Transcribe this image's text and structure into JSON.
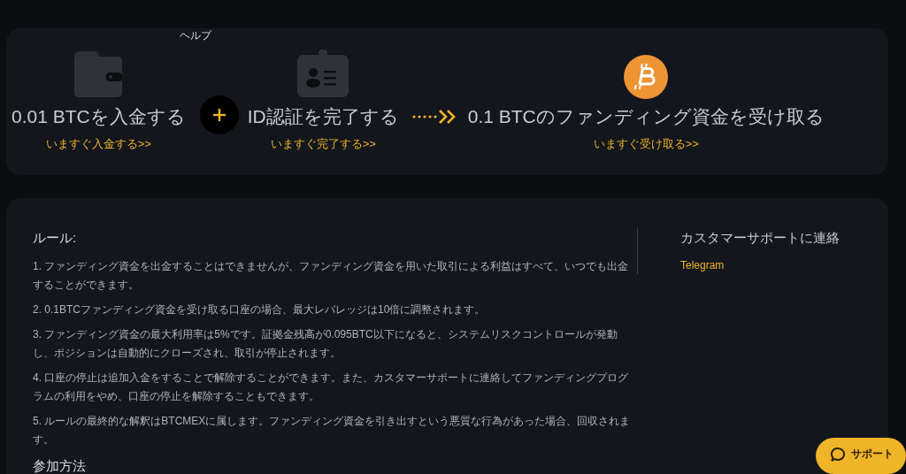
{
  "help_label": "ヘルプ",
  "steps": [
    {
      "kind": "wallet",
      "title": "0.01 BTCを入金する",
      "link": "いますぐ入金する>>"
    },
    {
      "kind": "id-card",
      "title": "ID認証を完了する",
      "link": "いますぐ完了する>>"
    },
    {
      "kind": "bitcoin",
      "title": "0.1 BTCのファンディング資金を受け取る",
      "link": "いますぐ受け取る>>"
    }
  ],
  "connectors": [
    {
      "kind": "plus"
    },
    {
      "kind": "arrow"
    }
  ],
  "rules": {
    "title": "ルール:",
    "items": [
      "1. ファンディング資金を出金することはできませんが、ファンディング資金を用いた取引による利益はすべて、いつでも出金することができます。",
      "2. 0.1BTCファンディング資金を受け取る口座の場合、最大レバレッジは10倍に調整されます。",
      "3. ファンディング資金の最大利用率は5%です。証拠金残高が0.095BTC以下になると、システムリスクコントロールが発動し、ポジションは自動的にクローズされ、取引が停止されます。",
      "4. 口座の停止は追加入金をすることで解除することができます。また、カスタマーサポートに連絡してファンディングプログラムの利用をやめ、口座の停止を解除することもできます。",
      "5. ルールの最終的な解釈はBTCMEXに属します。ファンディング資金を引き出すという悪質な行為があった場合、回収されます。"
    ],
    "how_to_join": "参加方法"
  },
  "contact": {
    "title": "カスタマーサポートに連絡",
    "link": "Telegram"
  },
  "support_button": "サポート"
}
